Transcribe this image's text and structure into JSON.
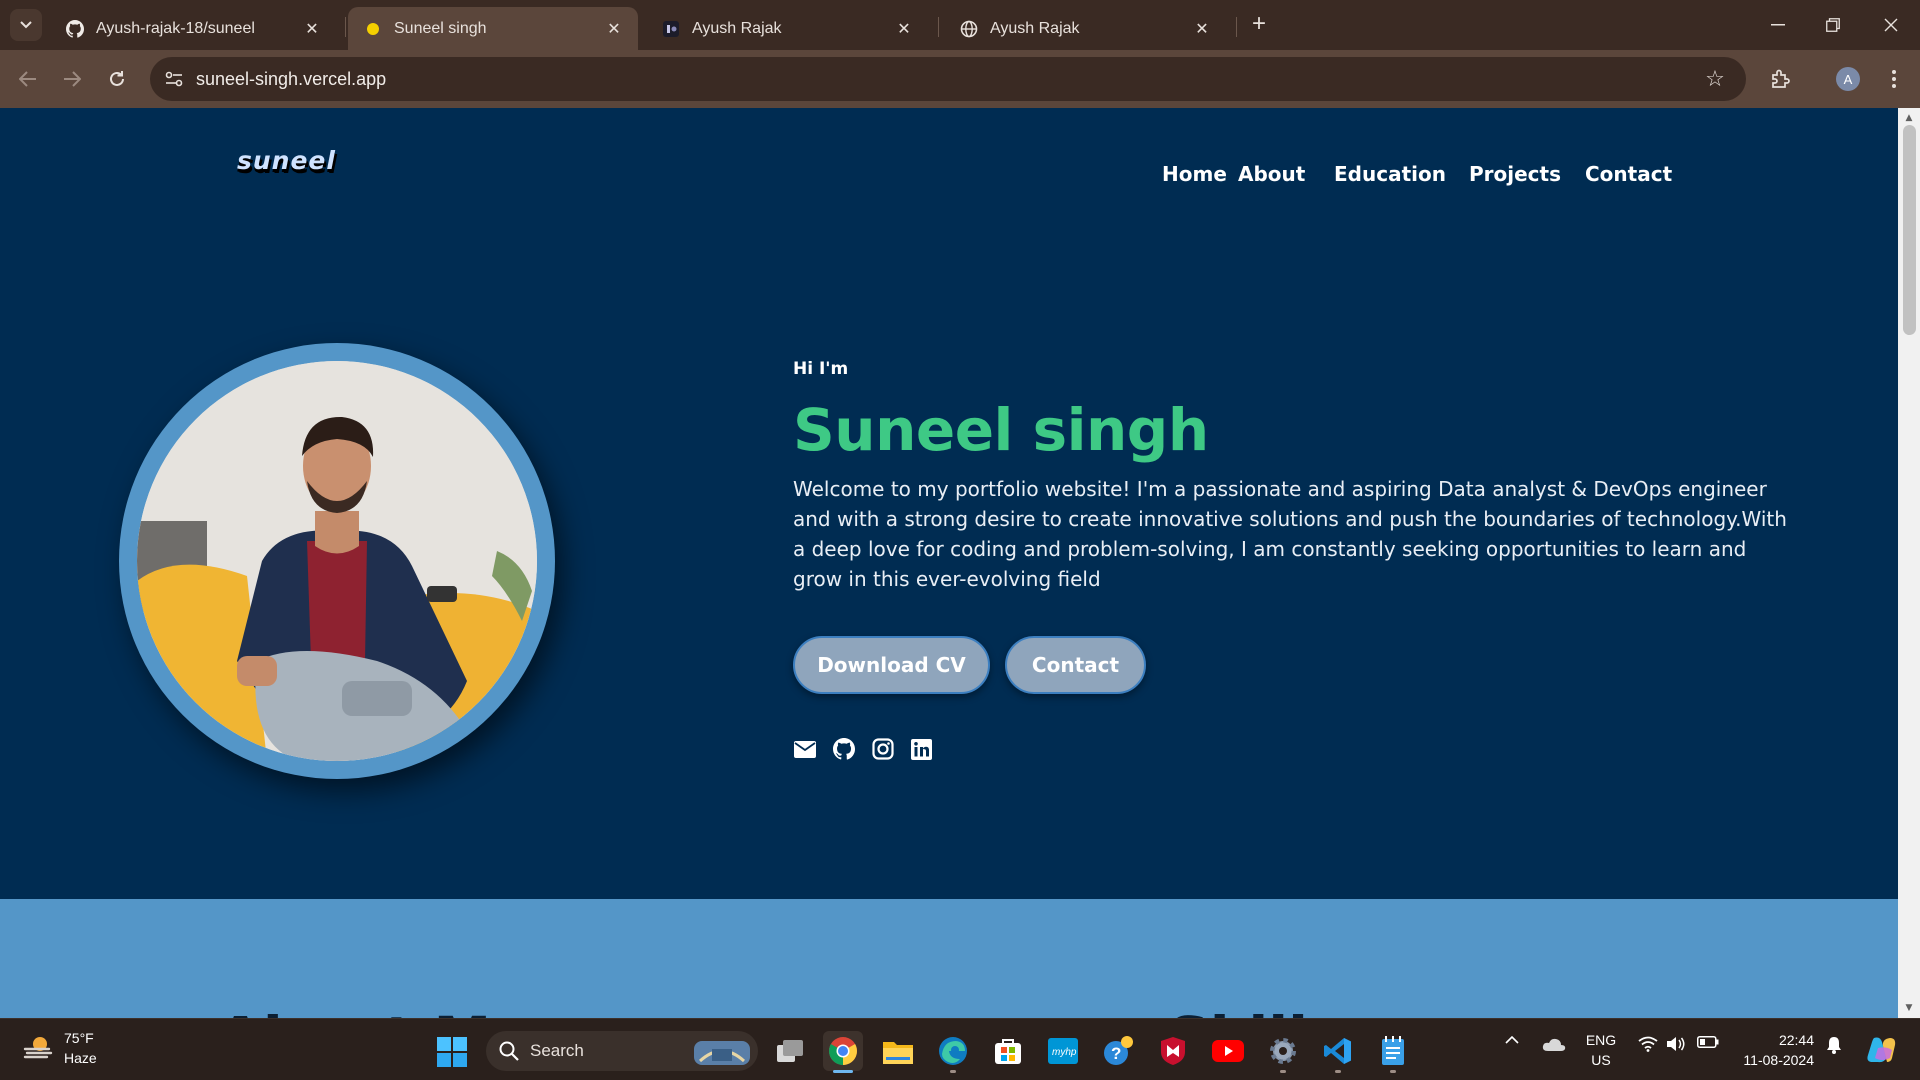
{
  "browser": {
    "tabs": [
      {
        "title": "Ayush-rajak-18/suneel",
        "icon": "github-icon",
        "active": false
      },
      {
        "title": "Suneel singh",
        "icon": "yellow-dot-icon",
        "active": true
      },
      {
        "title": "Ayush Rajak",
        "icon": "site-favicon-icon",
        "active": false
      },
      {
        "title": "Ayush Rajak",
        "icon": "globe-icon",
        "active": false
      }
    ],
    "url": "suneel-singh.vercel.app",
    "profile_initial": "A"
  },
  "page": {
    "logo": "suneel",
    "nav": [
      "Home",
      "About",
      "Education",
      "Projects",
      "Contact"
    ],
    "hero": {
      "greeting": "Hi I'm",
      "name": "Suneel singh",
      "intro": "Welcome to my portfolio website! I'm a passionate and aspiring Data analyst & DevOps engineer and with a strong desire to create innovative solutions and push the boundaries of technology.With a deep love for coding and problem-solving, I am constantly seeking opportunities to learn and grow in this ever-evolving field",
      "buttons": {
        "download": "Download CV",
        "contact": "Contact"
      },
      "social_icons": [
        "email-icon",
        "github-icon",
        "instagram-icon",
        "linkedin-icon"
      ]
    },
    "lower": {
      "left_heading": "About M",
      "right_heading": "Skill"
    },
    "colors": {
      "background": "#002c52",
      "accent": "#3ec985",
      "ring": "#5496c8",
      "button": "#8fa5bc"
    }
  },
  "taskbar": {
    "weather": {
      "temp": "75°F",
      "condition": "Haze"
    },
    "search_label": "Search",
    "apps": [
      "task-view-icon",
      "chrome-icon",
      "file-explorer-icon",
      "edge-icon",
      "microsoft-store-icon",
      "myhp-icon",
      "help-icon",
      "mcafee-icon",
      "youtube-icon",
      "settings-icon",
      "vscode-icon",
      "notepad-icon"
    ],
    "lang": {
      "line1": "ENG",
      "line2": "US"
    },
    "clock": {
      "time": "22:44",
      "date": "11-08-2024"
    }
  }
}
